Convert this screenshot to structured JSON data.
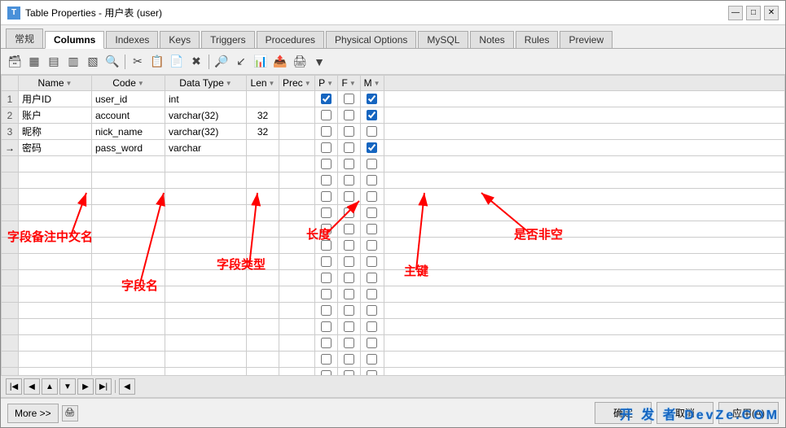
{
  "window": {
    "title": "Table Properties - 用户表 (user)",
    "icon": "T"
  },
  "tabs": [
    {
      "label": "常规",
      "active": false
    },
    {
      "label": "Columns",
      "active": true
    },
    {
      "label": "Indexes",
      "active": false
    },
    {
      "label": "Keys",
      "active": false
    },
    {
      "label": "Triggers",
      "active": false
    },
    {
      "label": "Procedures",
      "active": false
    },
    {
      "label": "Physical Options",
      "active": false
    },
    {
      "label": "MySQL",
      "active": false
    },
    {
      "label": "Notes",
      "active": false
    },
    {
      "label": "Rules",
      "active": false
    },
    {
      "label": "Preview",
      "active": false
    }
  ],
  "toolbar": {
    "buttons": [
      "🖼",
      "⊞",
      "⊟",
      "⊠",
      "⊡",
      "🔎",
      "✂",
      "📋",
      "📋",
      "✖",
      "🔍",
      "↙",
      "📊",
      "📤",
      "🖨"
    ]
  },
  "grid": {
    "headers": [
      {
        "label": "Name",
        "sort": "▼"
      },
      {
        "label": "Code",
        "sort": "▼"
      },
      {
        "label": "Data Type",
        "sort": "▼"
      },
      {
        "label": "Len",
        "sort": "▼"
      },
      {
        "label": "Prec",
        "sort": "▼"
      },
      {
        "label": "P",
        "sort": "▼"
      },
      {
        "label": "F",
        "sort": "▼"
      },
      {
        "label": "M",
        "sort": "▼"
      }
    ],
    "rows": [
      {
        "num": "1",
        "arrow": false,
        "name": "用户ID",
        "code": "user_id",
        "datatype": "int",
        "len": "",
        "prec": "",
        "P": true,
        "F": false,
        "M": true
      },
      {
        "num": "2",
        "arrow": false,
        "name": "账户",
        "code": "account",
        "datatype": "varchar(32)",
        "len": "32",
        "prec": "",
        "P": false,
        "F": false,
        "M": true
      },
      {
        "num": "3",
        "arrow": false,
        "name": "昵称",
        "code": "nick_name",
        "datatype": "varchar(32)",
        "len": "32",
        "prec": "",
        "P": false,
        "F": false,
        "M": false
      },
      {
        "num": "",
        "arrow": true,
        "name": "密码",
        "code": "pass_word",
        "datatype": "varchar",
        "len": "",
        "prec": "",
        "P": false,
        "F": false,
        "M": true
      },
      {
        "num": "",
        "arrow": false,
        "name": "",
        "code": "",
        "datatype": "",
        "len": "",
        "prec": "",
        "P": false,
        "F": false,
        "M": false
      },
      {
        "num": "",
        "arrow": false,
        "name": "",
        "code": "",
        "datatype": "",
        "len": "",
        "prec": "",
        "P": false,
        "F": false,
        "M": false
      },
      {
        "num": "",
        "arrow": false,
        "name": "",
        "code": "",
        "datatype": "",
        "len": "",
        "prec": "",
        "P": false,
        "F": false,
        "M": false
      },
      {
        "num": "",
        "arrow": false,
        "name": "",
        "code": "",
        "datatype": "",
        "len": "",
        "prec": "",
        "P": false,
        "F": false,
        "M": false
      },
      {
        "num": "",
        "arrow": false,
        "name": "",
        "code": "",
        "datatype": "",
        "len": "",
        "prec": "",
        "P": false,
        "F": false,
        "M": false
      },
      {
        "num": "",
        "arrow": false,
        "name": "",
        "code": "",
        "datatype": "",
        "len": "",
        "prec": "",
        "P": false,
        "F": false,
        "M": false
      },
      {
        "num": "",
        "arrow": false,
        "name": "",
        "code": "",
        "datatype": "",
        "len": "",
        "prec": "",
        "P": false,
        "F": false,
        "M": false
      },
      {
        "num": "",
        "arrow": false,
        "name": "",
        "code": "",
        "datatype": "",
        "len": "",
        "prec": "",
        "P": false,
        "F": false,
        "M": false
      },
      {
        "num": "",
        "arrow": false,
        "name": "",
        "code": "",
        "datatype": "",
        "len": "",
        "prec": "",
        "P": false,
        "F": false,
        "M": false
      },
      {
        "num": "",
        "arrow": false,
        "name": "",
        "code": "",
        "datatype": "",
        "len": "",
        "prec": "",
        "P": false,
        "F": false,
        "M": false
      },
      {
        "num": "",
        "arrow": false,
        "name": "",
        "code": "",
        "datatype": "",
        "len": "",
        "prec": "",
        "P": false,
        "F": false,
        "M": false
      },
      {
        "num": "",
        "arrow": false,
        "name": "",
        "code": "",
        "datatype": "",
        "len": "",
        "prec": "",
        "P": false,
        "F": false,
        "M": false
      },
      {
        "num": "",
        "arrow": false,
        "name": "",
        "code": "",
        "datatype": "",
        "len": "",
        "prec": "",
        "P": false,
        "F": false,
        "M": false
      },
      {
        "num": "",
        "arrow": false,
        "name": "",
        "code": "",
        "datatype": "",
        "len": "",
        "prec": "",
        "P": false,
        "F": false,
        "M": false
      }
    ]
  },
  "nav_buttons": [
    "first",
    "prev",
    "prev-small",
    "next",
    "next-small",
    "last"
  ],
  "annotations": {
    "field_name_label": "字段备注中文名",
    "field_code_label": "字段名",
    "field_type_label": "字段类型",
    "length_label": "长度",
    "primary_key_label": "主键",
    "not_null_label": "是否非空"
  },
  "action_bar": {
    "more_label": "More >>",
    "icon_btn": "🖨",
    "confirm_label": "确定",
    "cancel_label": "取消",
    "apply_label": "应用(A)"
  },
  "watermark": "开 发 者 DevZe.COM"
}
